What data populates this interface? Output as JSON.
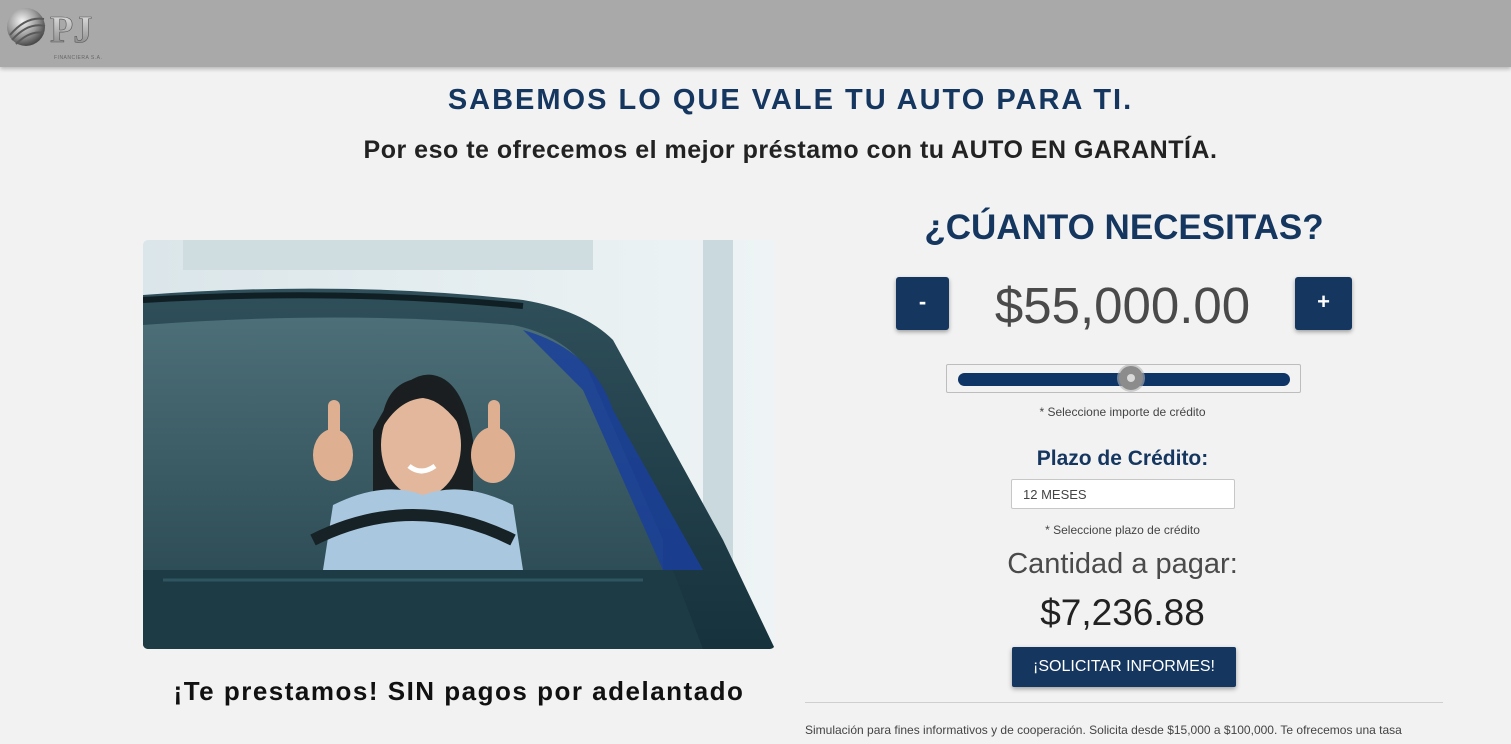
{
  "header": {
    "logo_text": "PJ",
    "logo_subtext": "FINANCIERA S.A.",
    "background_color": "#a9a9a9"
  },
  "hero": {
    "headline": "SABEMOS LO QUE VALE TU AUTO PARA TI.",
    "subheadline": "Por eso te ofrecemos el mejor préstamo con tu AUTO EN GARANTÍA.",
    "promo": "¡Te prestamos! SIN pagos por adelantado"
  },
  "calculator": {
    "title": "¿CÚANTO NECESITAS?",
    "minus_label": "-",
    "plus_label": "+",
    "amount": "$55,000.00",
    "slider_value": 55000,
    "slider_min": 15000,
    "slider_max": 100000,
    "amount_hint": "* Seleccione importe de crédito",
    "plazo_label": "Plazo de Crédito:",
    "plazo_selected": "12 MESES",
    "plazo_hint": "* Seleccione plazo de crédito",
    "pay_label": "Cantidad a pagar:",
    "pay_value": "$7,236.88",
    "cta_label": "¡SOLICITAR INFORMES!",
    "disclaimer": "Simulación para fines informativos y de cooperación. Solicita desde $15,000 a $100,000. Te ofrecemos una tasa"
  },
  "colors": {
    "brand_blue": "#14365f",
    "page_background": "#f2f2f2"
  },
  "icons": {
    "logo": "pj-globe-logo"
  }
}
